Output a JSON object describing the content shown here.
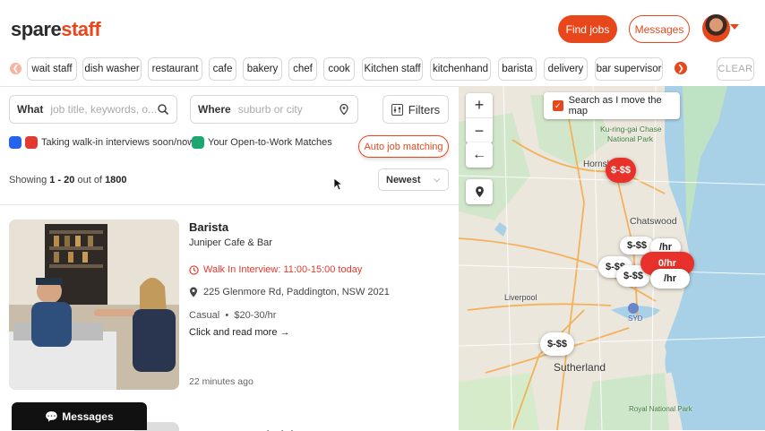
{
  "brand": {
    "logo_part1": "spare",
    "logo_part2": "staff"
  },
  "header": {
    "find_jobs": "Find jobs",
    "messages": "Messages"
  },
  "chips": [
    "wait staff",
    "dish washer",
    "restaurant",
    "cafe",
    "bakery",
    "chef",
    "cook",
    "Kitchen staff",
    "kitchenhand",
    "barista",
    "delivery",
    "bar supervisor"
  ],
  "chips_clear": "CLEAR",
  "search": {
    "what_label": "What",
    "what_placeholder": "job title, keywords, o...",
    "where_label": "Where",
    "where_placeholder": "suburb or city",
    "filters": "Filters"
  },
  "legend": {
    "walkin": "Taking walk-in interviews soon/now",
    "open": "Your Open-to-Work Matches",
    "auto": "Auto job matching",
    "colors": {
      "blue": "#2563eb",
      "red": "#e23a2e",
      "green": "#1ea672"
    }
  },
  "results": {
    "showing_label": "Showing",
    "range": "1 - 20",
    "out_of": "out of",
    "total": "1800",
    "sort": "Newest"
  },
  "job": {
    "title": "Barista",
    "company": "Juniper Cafe & Bar",
    "walkin": "Walk In Interview: 11:00-15:00 today",
    "address": "225 Glenmore Rd, Paddington, NSW 2021",
    "type": "Casual",
    "pay": "$20-30/hr",
    "read_more": "Click and read more",
    "posted": "22 minutes ago"
  },
  "next_job": {
    "title": "Computer Technician"
  },
  "messages_bar": "Messages",
  "map": {
    "search_as_move": "Search as I move the map",
    "zoom_in": "+",
    "zoom_out": "−",
    "places": {
      "hornsby": "Hornsby",
      "chatswood": "Chatswood",
      "liverpool": "Liverpool",
      "sutherland": "Sutherland",
      "kuringgai": "Ku-ring-gai Chase",
      "national_park": "National Park",
      "syd": "SYD",
      "royal": "Royal National Park"
    },
    "pins": {
      "p1": "$-$$",
      "p2": "$-$$",
      "p3": "/hr",
      "p4": "$-$$",
      "p5": "$-$$",
      "p6": "0/hr",
      "p7": "/hr",
      "p8": "$-$$"
    }
  }
}
